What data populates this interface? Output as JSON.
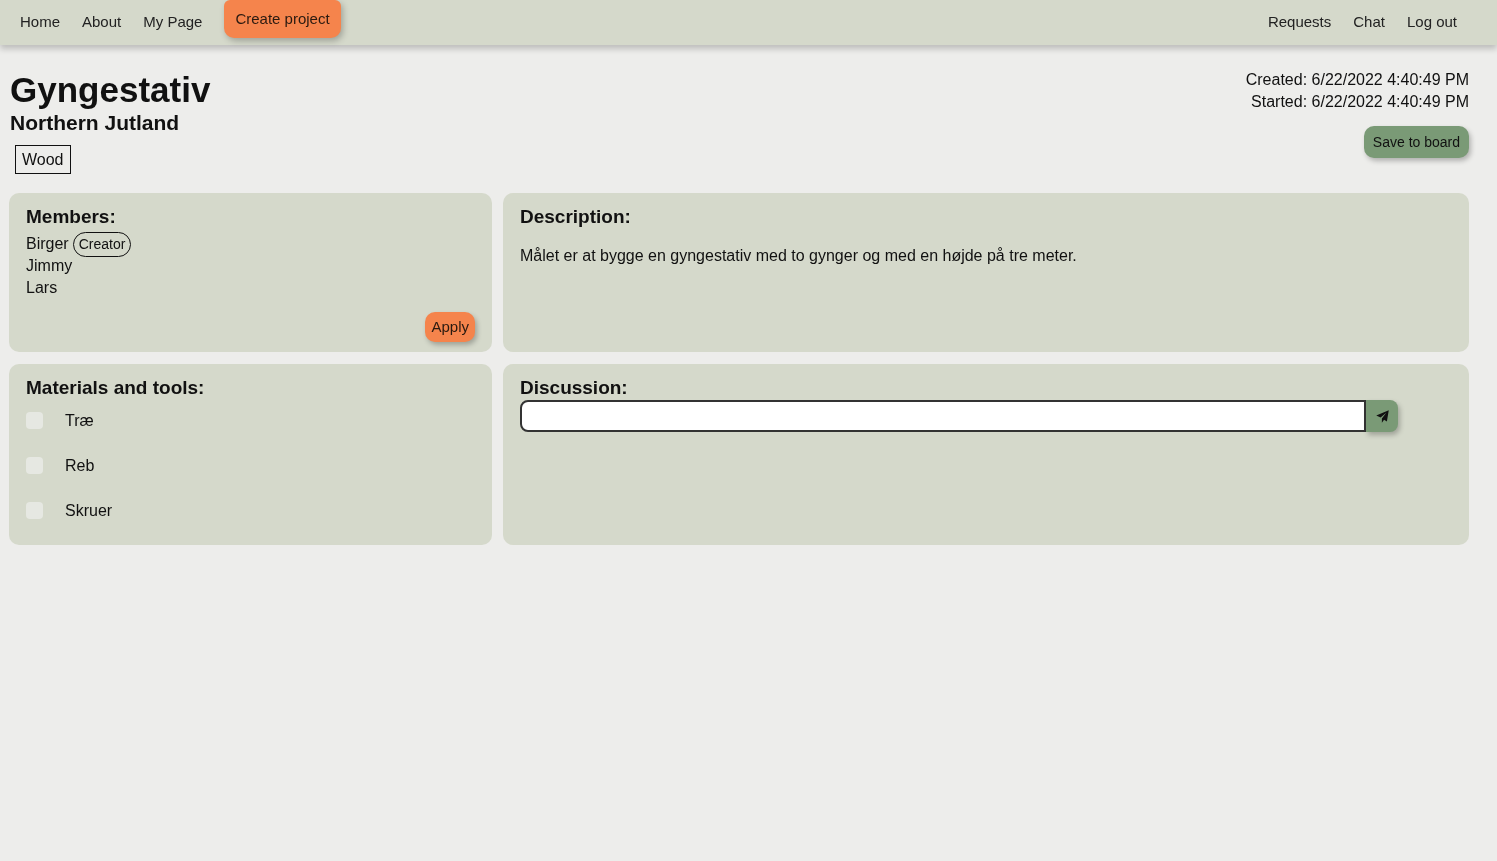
{
  "nav": {
    "left_items": [
      {
        "label": "Home",
        "kind": "link"
      },
      {
        "label": "About",
        "kind": "link"
      },
      {
        "label": "My Page",
        "kind": "link"
      },
      {
        "label": "Create project",
        "kind": "button"
      }
    ],
    "right_items": [
      {
        "label": "Requests",
        "kind": "link"
      },
      {
        "label": "Chat",
        "kind": "link"
      },
      {
        "label": "Log out",
        "kind": "link"
      }
    ]
  },
  "project": {
    "title": "Gyngestativ",
    "region": "Northern Jutland",
    "tags": [
      "Wood"
    ],
    "created": "Created: 6/22/2022 4:40:49 PM",
    "started": "Started: 6/22/2022 4:40:49 PM",
    "save_button": "Save to board"
  },
  "members": {
    "heading": "Members:",
    "items": [
      {
        "name": "Birger",
        "badge": "Creator"
      },
      {
        "name": "Jimmy"
      },
      {
        "name": "Lars"
      }
    ],
    "apply_button": "Apply"
  },
  "description": {
    "heading": "Description:",
    "text": "Målet er at bygge en gyngestativ med to gynger og med en højde på tre meter."
  },
  "materials": {
    "heading": "Materials and tools:",
    "items": [
      {
        "label": "Træ",
        "checked": false
      },
      {
        "label": "Reb",
        "checked": false
      },
      {
        "label": "Skruer",
        "checked": false
      }
    ]
  },
  "discussion": {
    "heading": "Discussion:"
  }
}
